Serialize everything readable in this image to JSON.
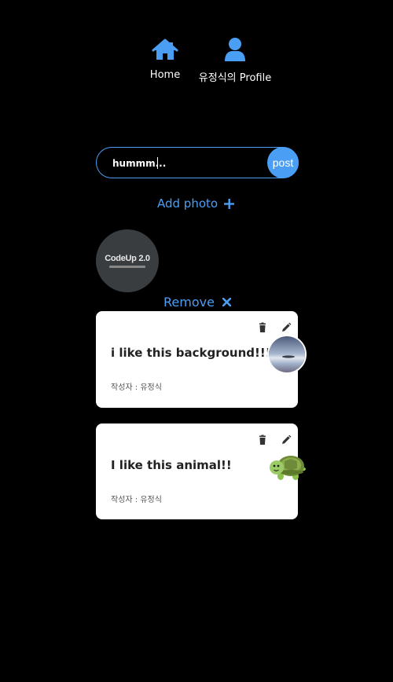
{
  "nav": {
    "home_label": "Home",
    "profile_label": "유정식의 Profile",
    "home_icon": "home-icon",
    "profile_icon": "user-icon",
    "icon_color": "#4a9ff5"
  },
  "composer": {
    "value": "hummm...",
    "post_label": "post",
    "accent": "#4a9ff5"
  },
  "attachment": {
    "add_label": "Add photo",
    "add_icon": "plus-icon",
    "preview_text": "CodeUp 2.0",
    "remove_label": "Remove",
    "remove_icon": "close-icon"
  },
  "posts": [
    {
      "text": "i like this background!!!",
      "author": "작성자 : 유정식",
      "thumbnail": "background-photo"
    },
    {
      "text": "I like this animal!!",
      "author": "작성자 : 유정식",
      "thumbnail": "turtle-emoji"
    }
  ]
}
